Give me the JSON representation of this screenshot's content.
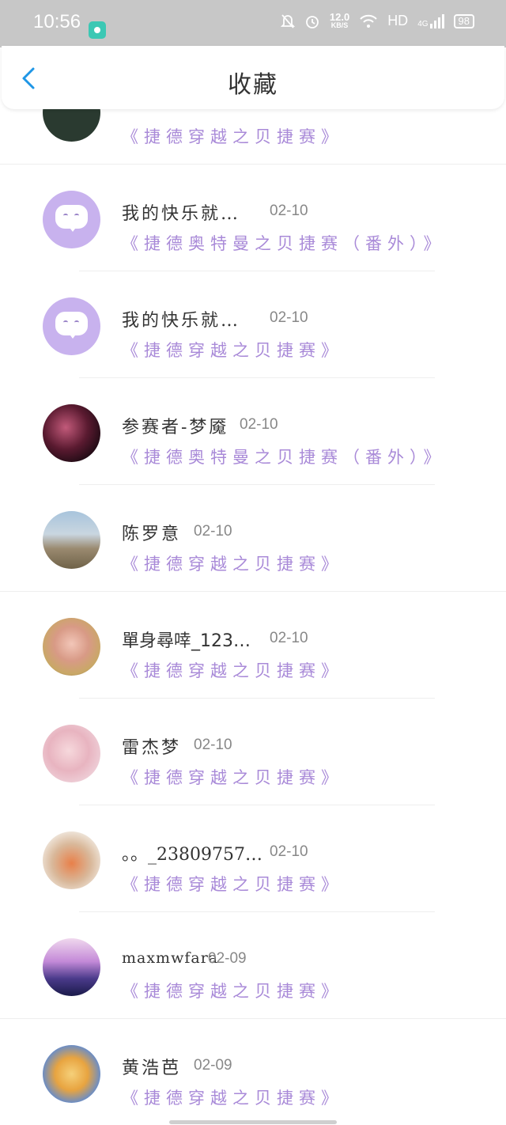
{
  "status_bar": {
    "time": "10:56",
    "net_speed": "12.0",
    "net_unit": "KB/S",
    "hd": "HD",
    "network": "4G",
    "battery": "98"
  },
  "header": {
    "title": "收藏"
  },
  "colors": {
    "accent_purple": "#a98ad8",
    "back_arrow": "#1f96e6",
    "status_bar_bg": "#c7c7c7"
  },
  "items": [
    {
      "name": "",
      "date": "",
      "book": "《捷德穿越之贝捷赛》",
      "avatar": "photo-dark"
    },
    {
      "name": "我的快乐就…",
      "date": "02-10",
      "book": "《捷德奥特曼之贝捷赛（番外）》",
      "avatar": "default-chat-icon"
    },
    {
      "name": "我的快乐就…",
      "date": "02-10",
      "book": "《捷德穿越之贝捷赛》",
      "avatar": "default-chat-icon"
    },
    {
      "name": "参赛者-梦魇",
      "date": "02-10",
      "book": "《捷德奥特曼之贝捷赛（番外）》",
      "avatar": "photo-artwork"
    },
    {
      "name": "陈罗意",
      "date": "02-10",
      "book": "《捷德穿越之贝捷赛》",
      "avatar": "photo-child"
    },
    {
      "name": "單身尋啈_123…",
      "date": "02-10",
      "book": "《捷德穿越之贝捷赛》",
      "avatar": "photo-girl"
    },
    {
      "name": "雷杰梦",
      "date": "02-10",
      "book": "《捷德穿越之贝捷赛》",
      "avatar": "photo-girl-umbrella"
    },
    {
      "name": "。。_23809757…",
      "date": "02-10",
      "book": "《捷德穿越之贝捷赛》",
      "avatar": "photo-cartoon-fox"
    },
    {
      "name": "maxmwfara",
      "date": "02-09",
      "book": "《捷德穿越之贝捷赛》",
      "avatar": "photo-city-night"
    },
    {
      "name": "黄浩芭",
      "date": "02-09",
      "book": "《捷德穿越之贝捷赛》",
      "avatar": "photo-anime-ninja"
    }
  ]
}
